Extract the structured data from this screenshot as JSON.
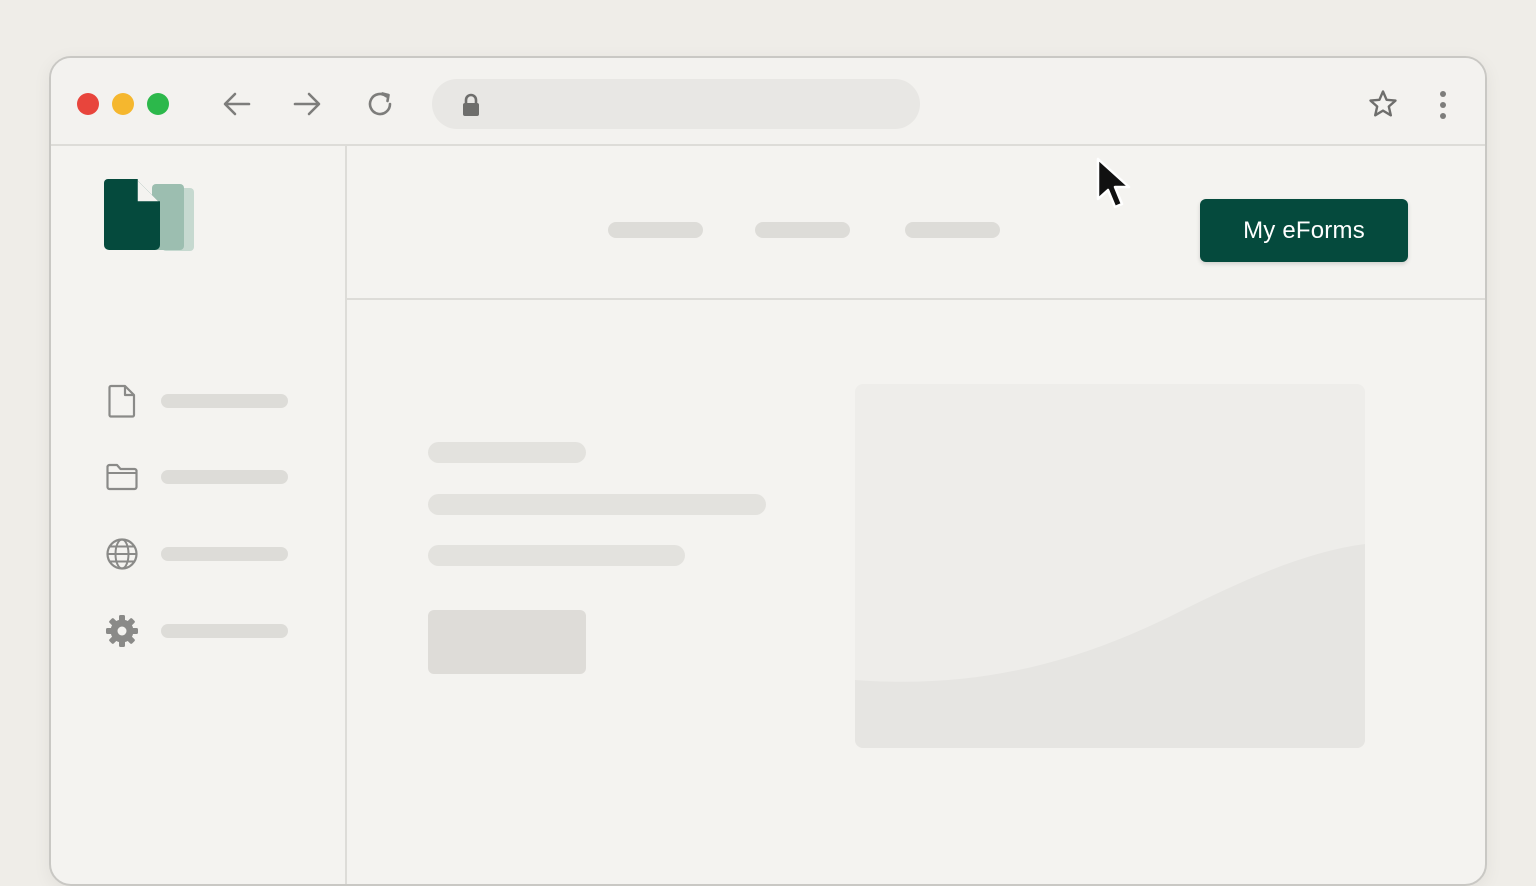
{
  "window": {
    "controls": [
      "close",
      "minimize",
      "maximize"
    ],
    "colors": {
      "close": "#e8453c",
      "minimize": "#f5b72e",
      "maximize": "#2cb84b"
    }
  },
  "toolbar": {
    "icons": [
      "back-arrow-icon",
      "forward-arrow-icon",
      "reload-icon",
      "lock-icon",
      "star-icon",
      "more-vert-icon"
    ],
    "address": ""
  },
  "sidebar": {
    "logo": "documents-logo",
    "items": [
      {
        "icon": "file-icon",
        "label": ""
      },
      {
        "icon": "folder-icon",
        "label": ""
      },
      {
        "icon": "globe-icon",
        "label": ""
      },
      {
        "icon": "gear-icon",
        "label": ""
      }
    ]
  },
  "header": {
    "nav_items": [
      "",
      "",
      ""
    ],
    "cta_label": "My eForms"
  },
  "colors": {
    "brand": "#054a3d",
    "brand_light": "#9cbeb0",
    "placeholder": "#dddcd8",
    "icon": "#8a8a88"
  }
}
